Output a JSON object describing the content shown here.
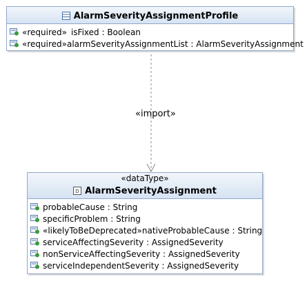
{
  "profile": {
    "name": "AlarmSeverityAssignmentProfile",
    "attributes": [
      {
        "stereotype": "«required»",
        "text": "isFixed : Boolean"
      },
      {
        "stereotype": "«required»",
        "text": "alarmSeverityAssignmentList : AlarmSeverityAssignment"
      }
    ]
  },
  "dependency": {
    "label": "«import»"
  },
  "assignment": {
    "stereotype": "«dataType»",
    "name": "AlarmSeverityAssignment",
    "attributes": [
      {
        "text": "probableCause : String"
      },
      {
        "text": "specificProblem : String"
      },
      {
        "stereotype": "«likelyToBeDeprecated»",
        "text": "nativeProbableCause : String"
      },
      {
        "text": "serviceAffectingSeverity : AssignedSeverity"
      },
      {
        "text": "nonServiceAffectingSeverity : AssignedSeverity"
      },
      {
        "text": "serviceIndependentSeverity : AssignedSeverity"
      }
    ]
  },
  "colors": {
    "border": "#8fa7c9",
    "header": "#d6e3f3",
    "attribute_icon": "#3a9a3a"
  },
  "icons": {
    "class": "class-icon",
    "datatype": "datatype-icon",
    "attribute": "attribute-icon"
  }
}
